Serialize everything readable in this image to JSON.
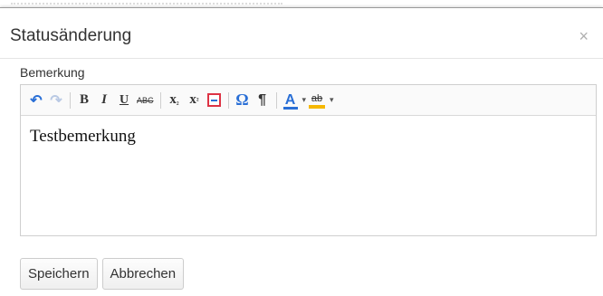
{
  "dialog": {
    "title": "Statusänderung",
    "close_symbol": "×"
  },
  "field": {
    "label": "Bemerkung",
    "value": "Testbemerkung"
  },
  "toolbar": {
    "undo": "↶",
    "redo": "↷",
    "bold": "B",
    "italic": "I",
    "underline": "U",
    "strike": "ABC",
    "subscript": "x",
    "superscript": "x",
    "omega": "Ω",
    "pilcrow": "¶",
    "font_color": "A",
    "highlight": "ab",
    "dropdown_caret": "▾"
  },
  "buttons": {
    "save": "Speichern",
    "cancel": "Abbrechen"
  },
  "colors": {
    "accent": "#2a6fd6",
    "highlight": "#f6b800"
  }
}
